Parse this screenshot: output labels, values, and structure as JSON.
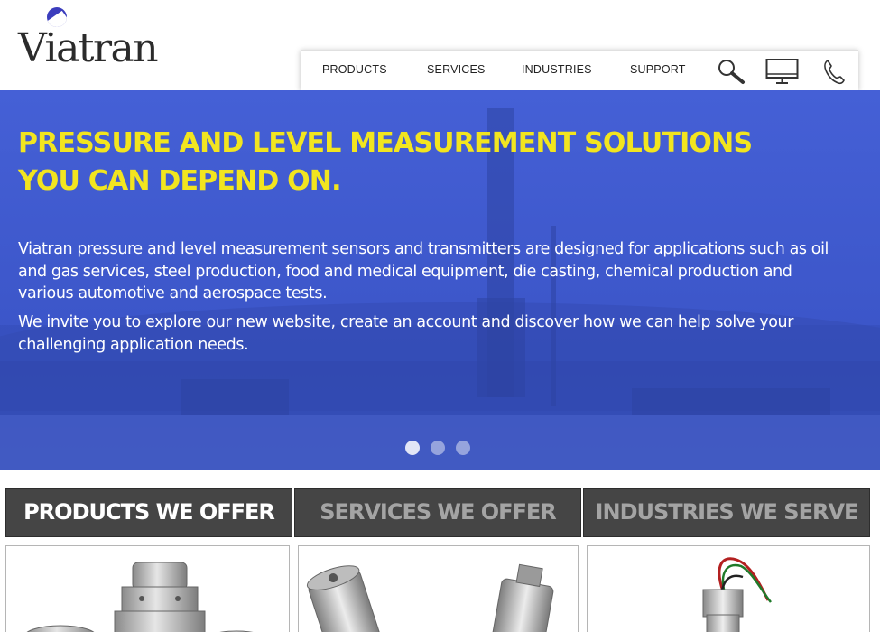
{
  "brand": {
    "logo_text": "Viatran",
    "accent": "#3b3dbd"
  },
  "nav": {
    "items": [
      {
        "label": "PRODUCTS"
      },
      {
        "label": "SERVICES"
      },
      {
        "label": "INDUSTRIES"
      },
      {
        "label": "SUPPORT"
      }
    ],
    "icons": [
      "search-icon",
      "monitor-icon",
      "phone-icon"
    ]
  },
  "hero": {
    "title_line1": "PRESSURE AND LEVEL MEASUREMENT SOLUTIONS",
    "title_line2": "YOU CAN DEPEND ON.",
    "para1_line1": "Viatran pressure and level measurement sensors and transmitters are designed for applications such as oil",
    "para1_line2": "and gas services, steel production, food and medical equipment, die casting, chemical production and",
    "para1_line3": "various automotive and aerospace tests.",
    "para2_line1": "We invite you to explore our new website, create an account and discover how we can help solve your",
    "para2_line2": "challenging application needs.",
    "title_color": "#f2e51f",
    "overlay_color": "#3d55c9",
    "slides": 3,
    "active_slide": 1
  },
  "tabs": [
    {
      "label": "PRODUCTS WE OFFER",
      "active": true
    },
    {
      "label": "SERVICES WE OFFER",
      "active": false
    },
    {
      "label": "INDUSTRIES WE SERVE",
      "active": false
    }
  ]
}
